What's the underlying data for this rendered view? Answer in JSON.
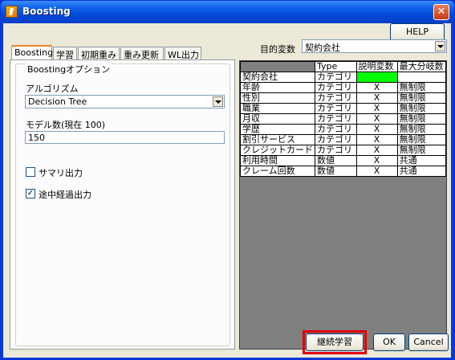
{
  "window": {
    "title": "Boosting",
    "app_icon": "app-logo-icon",
    "close_icon": "close-icon",
    "close_glyph": "✕"
  },
  "header": {
    "help_label": "HELP",
    "target_label": "目的変数",
    "target_value": "契約会社"
  },
  "tabs": [
    "Boosting",
    "学習",
    "初期重み",
    "重み更新",
    "WL出力"
  ],
  "options": {
    "group_title": "Boostingオプション",
    "algorithm_label": "アルゴリズム",
    "algorithm_value": "Decision Tree",
    "model_count_label": "モデル数(現在 100)",
    "model_count_value": "150",
    "summary_label": "サマリ出力",
    "summary_checked": false,
    "progress_label": "途中経過出力",
    "progress_checked": true,
    "check_glyph": "✓"
  },
  "grid": {
    "headers": [
      "",
      "Type",
      "説明変数",
      "最大分岐数"
    ],
    "rows": [
      {
        "name": "契約会社",
        "type": "カテゴリ",
        "explanatory": "",
        "max_branch": "",
        "highlight": "#00ff00"
      },
      {
        "name": "年齢",
        "type": "カテゴリ",
        "explanatory": "X",
        "max_branch": "無制限"
      },
      {
        "name": "性別",
        "type": "カテゴリ",
        "explanatory": "X",
        "max_branch": "無制限"
      },
      {
        "name": "職業",
        "type": "カテゴリ",
        "explanatory": "X",
        "max_branch": "無制限"
      },
      {
        "name": "月収",
        "type": "カテゴリ",
        "explanatory": "X",
        "max_branch": "無制限"
      },
      {
        "name": "学歴",
        "type": "カテゴリ",
        "explanatory": "X",
        "max_branch": "無制限"
      },
      {
        "name": "割引サービス",
        "type": "カテゴリ",
        "explanatory": "X",
        "max_branch": "無制限"
      },
      {
        "name": "クレジットカード",
        "type": "カテゴリ",
        "explanatory": "X",
        "max_branch": "無制限"
      },
      {
        "name": "利用時間",
        "type": "数値",
        "explanatory": "X",
        "max_branch": "共通"
      },
      {
        "name": "クレーム回数",
        "type": "数値",
        "explanatory": "X",
        "max_branch": "共通"
      }
    ]
  },
  "footer": {
    "continue_label": "継続学習",
    "ok_label": "OK",
    "cancel_label": "Cancel",
    "highlight_color": "#e00000"
  }
}
